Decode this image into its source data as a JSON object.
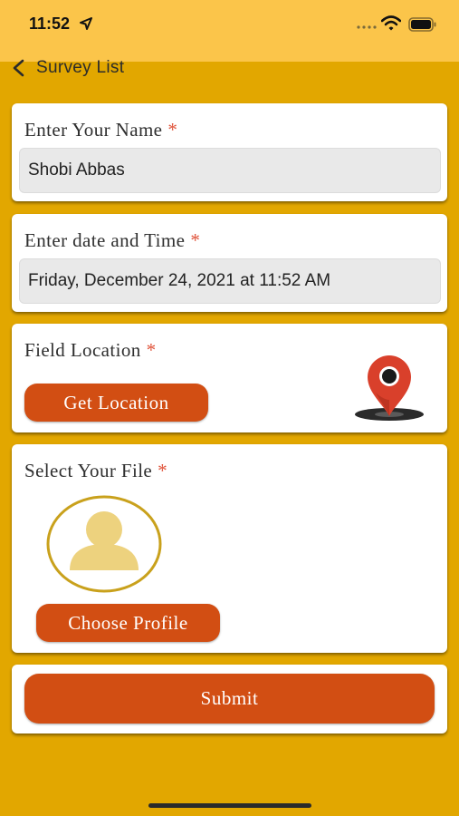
{
  "status_bar": {
    "time": "11:52"
  },
  "nav": {
    "back_label": "Survey List"
  },
  "name_card": {
    "label": "Enter Your Name",
    "required_mark": "*",
    "value": "Shobi Abbas"
  },
  "datetime_card": {
    "label": "Enter date and Time",
    "required_mark": "*",
    "value": "Friday, December 24, 2021 at 11:52 AM"
  },
  "location_card": {
    "label": "Field Location",
    "required_mark": "*",
    "button_label": "Get Location",
    "icon": "map-pin-icon"
  },
  "file_card": {
    "label": "Select Your File",
    "required_mark": "*",
    "avatar_icon": "person-placeholder-icon",
    "button_label": "Choose Profile"
  },
  "submit": {
    "label": "Submit"
  },
  "colors": {
    "background": "#e2a700",
    "status_bar": "#fbc54a",
    "button": "#d24e13",
    "required": "#e0533a",
    "avatar_ring": "#c9a11c",
    "avatar_fill": "#edd27e"
  }
}
